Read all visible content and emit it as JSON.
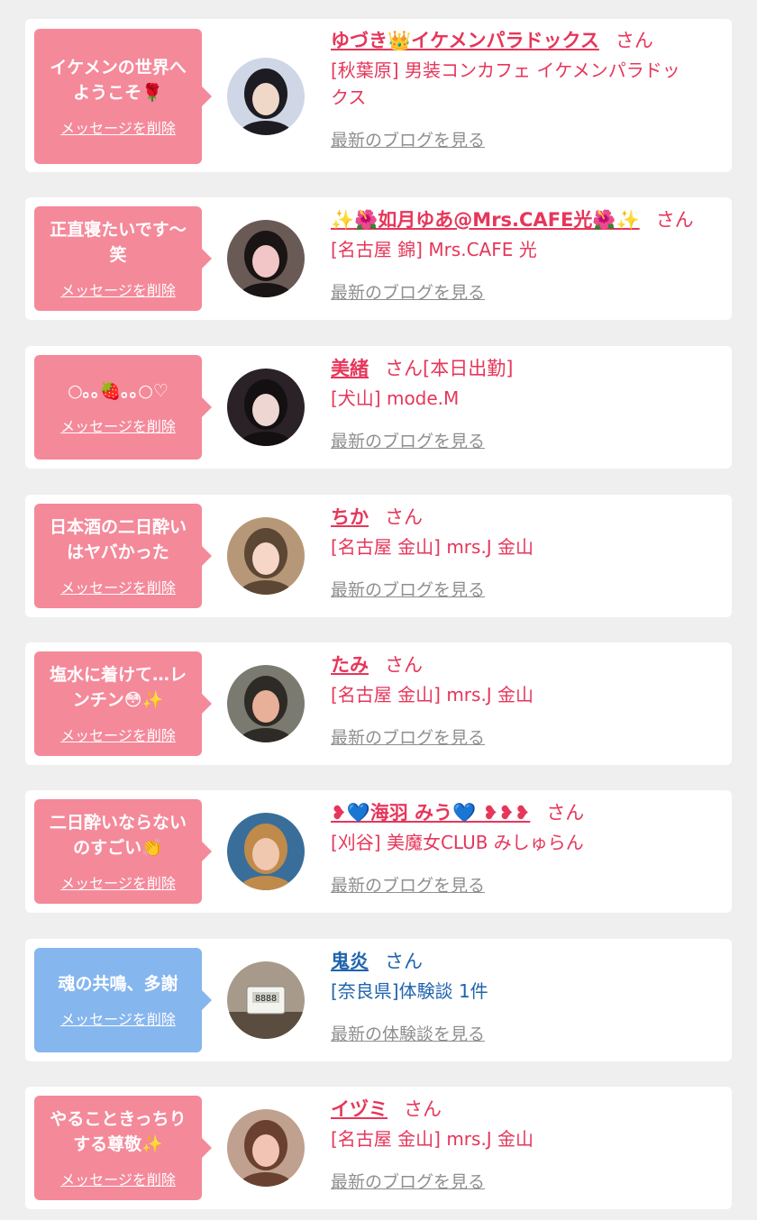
{
  "delete_label": "メッセージを削除",
  "colors": {
    "pink_bubble": "#f4899a",
    "blue_bubble": "#86b6ee",
    "pink_text": "#e6365a",
    "blue_text": "#1f64ad",
    "link_gray": "#8f8f8f"
  },
  "entries": [
    {
      "message_line1": "イケメンの世界へ",
      "message_line2": "ようこそ🌹",
      "name": "ゆづき👑イケメンパラドックス",
      "san": "さん",
      "shop_line1": "[秋葉原] 男装コンカフェ イケメンパラドッ",
      "shop_line2": "クス",
      "link": "最新のブログを見る",
      "theme": "pink",
      "avatar_icon": "avatar-photo-icon"
    },
    {
      "message_line1": "正直寝たいです〜",
      "message_line2": "笑",
      "name": "✨🌺如月ゆあ@Mrs.CAFE光🌺✨",
      "san": "さん",
      "shop_line1": "[名古屋 錦] Mrs.CAFE 光",
      "shop_line2": "",
      "link": "最新のブログを見る",
      "theme": "pink",
      "avatar_icon": "avatar-photo-icon"
    },
    {
      "message_line1": "○｡｡🍓｡｡○♡",
      "message_line2": "",
      "name": "美緒",
      "san": "さん[本日出勤]",
      "shop_line1": "[犬山] mode.M",
      "shop_line2": "",
      "link": "最新のブログを見る",
      "theme": "pink",
      "avatar_icon": "avatar-photo-icon"
    },
    {
      "message_line1": "日本酒の二日酔い",
      "message_line2": "はヤバかった",
      "name": "ちか",
      "san": "さん",
      "shop_line1": "[名古屋 金山] mrs.J 金山",
      "shop_line2": "",
      "link": "最新のブログを見る",
      "theme": "pink",
      "avatar_icon": "avatar-photo-icon"
    },
    {
      "message_line1": "塩水に着けて…レ",
      "message_line2": "ンチン😳✨",
      "name": "たみ",
      "san": "さん",
      "shop_line1": "[名古屋 金山] mrs.J 金山",
      "shop_line2": "",
      "link": "最新のブログを見る",
      "theme": "pink",
      "avatar_icon": "avatar-photo-icon"
    },
    {
      "message_line1": "二日酔いならない",
      "message_line2": "のすごい👏",
      "name": "❥💙海羽 みう💙 ❥❥❥",
      "san": "さん",
      "shop_line1": "[刈谷] 美魔女CLUB みしゅらん",
      "shop_line2": "",
      "link": "最新のブログを見る",
      "theme": "pink",
      "avatar_icon": "avatar-photo-icon"
    },
    {
      "message_line1": "魂の共鳴、多謝",
      "message_line2": "",
      "name": "鬼炎",
      "san": "さん",
      "shop_line1": "[奈良県]体験談 1件",
      "shop_line2": "",
      "link": "最新の体験談を見る",
      "theme": "blue",
      "avatar_icon": "timer-photo-icon"
    },
    {
      "message_line1": "やることきっちり",
      "message_line2": "する尊敬✨",
      "name": "イヅミ",
      "san": "さん",
      "shop_line1": "[名古屋 金山] mrs.J 金山",
      "shop_line2": "",
      "link": "最新のブログを見る",
      "theme": "pink",
      "avatar_icon": "avatar-photo-icon"
    }
  ]
}
